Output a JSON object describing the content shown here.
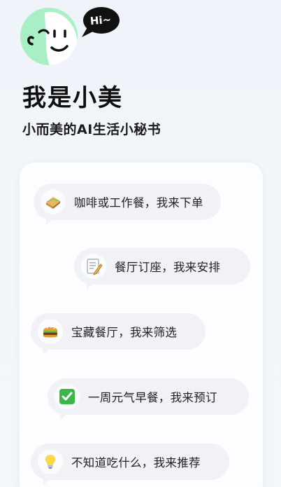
{
  "greeting": {
    "bubble_text": "Hi~"
  },
  "title": "我是小美",
  "subtitle": "小而美的AI生活小秘书",
  "features": [
    {
      "icon": "sandwich-icon",
      "label": "咖啡或工作餐，我来下单"
    },
    {
      "icon": "memo-icon",
      "label": "餐厅订座，我来安排"
    },
    {
      "icon": "burger-icon",
      "label": "宝藏餐厅，我来筛选"
    },
    {
      "icon": "check-icon",
      "label": "一周元气早餐，我来预订"
    },
    {
      "icon": "lightbulb-icon",
      "label": "不知道吃什么，我来推荐"
    }
  ],
  "colors": {
    "mascot_green": "#a8efc6",
    "bubble_black": "#111111",
    "check_green": "#3cb54a"
  }
}
